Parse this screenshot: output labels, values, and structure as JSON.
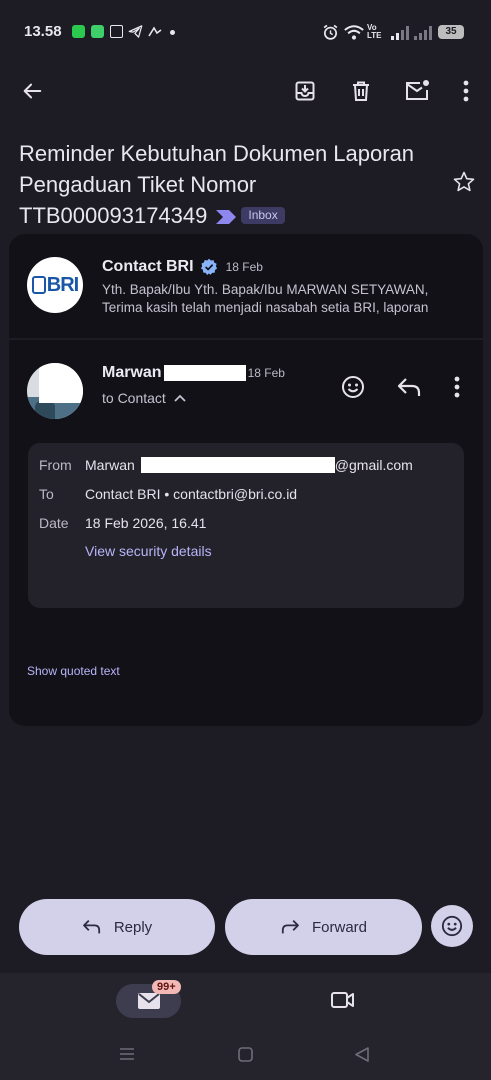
{
  "status_bar": {
    "time": "13.58",
    "network_label_top": "Vo",
    "network_label_bottom": "LTE",
    "battery": "35"
  },
  "toolbar": {
    "back_icon": "arrow-left-icon",
    "archive_icon": "archive-icon",
    "delete_icon": "trash-icon",
    "mark_unread_icon": "mail-unread-icon",
    "more_icon": "more-vert-icon"
  },
  "subject": {
    "text": "Reminder Kebutuhan Dokumen Laporan Pengaduan Tiket Nomor TTB000093174349",
    "label": "Inbox"
  },
  "message1": {
    "avatar_text": "BRI",
    "sender": "Contact BRI",
    "date": "18 Feb",
    "snippet": "Yth. Bapak/Ibu Yth. Bapak/Ibu MARWAN SETYAWAN, Terima kasih telah menjadi nasabah setia BRI, laporan"
  },
  "message2": {
    "sender": "Marwan",
    "date": "18 Feb",
    "to_line": "to Contact",
    "details": {
      "from_label": "From",
      "from_name": "Marwan",
      "from_email_suffix": "@gmail.com",
      "to_label": "To",
      "to_value": "Contact BRI • contactbri@bri.co.id",
      "date_label": "Date",
      "date_value": "18 Feb 2026, 16.41",
      "security_link": "View security details"
    },
    "show_quoted": "Show quoted text"
  },
  "actions": {
    "reply": "Reply",
    "forward": "Forward"
  },
  "bottom_nav": {
    "mail_badge": "99+"
  },
  "colors": {
    "background": "#1d1c24",
    "card": "#121117",
    "accent": "#b9b4f8",
    "pill": "#d3d0ea",
    "verified": "#8ab4f8"
  }
}
